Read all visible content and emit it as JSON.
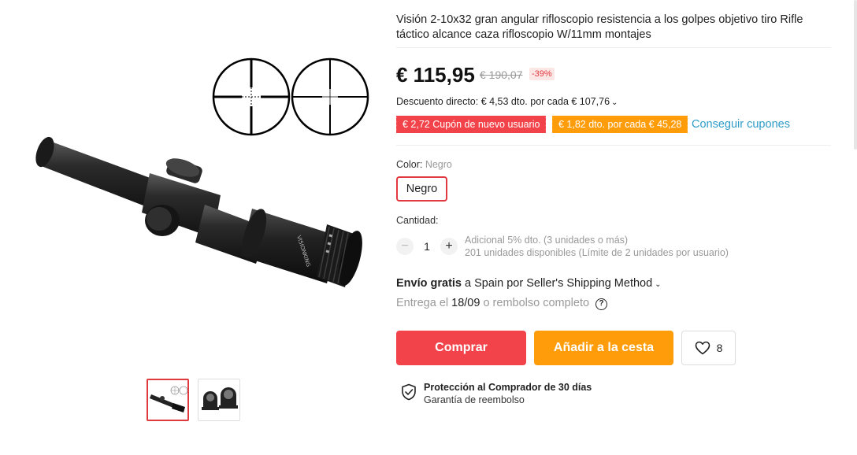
{
  "product": {
    "title": "Visión 2-10x32 gran angular rifloscopio resistencia a los golpes objetivo tiro Rifle táctico alcance caza rifloscopio W/11mm montajes"
  },
  "gallery": {
    "main_image_icon": "rifle-scope-with-reticles",
    "thumbnails": [
      {
        "icon": "rifle-scope-thumbnail",
        "active": true
      },
      {
        "icon": "scope-mounts-thumbnail",
        "active": false
      }
    ]
  },
  "pricing": {
    "price": "€ 115,95",
    "original_price": "€ 190,07",
    "discount_badge": "-39%",
    "direct_discount": "Descuento directo: € 4,53 dto. por cada € 107,76",
    "chevron": "⌄"
  },
  "coupons": {
    "new_user": "€ 2,72 Cupón de nuevo usuario",
    "store": "€ 1,82 dto. por cada € 45,28",
    "get_link": "Conseguir cupones"
  },
  "color": {
    "label": "Color:",
    "selected": "Negro",
    "options": [
      "Negro"
    ]
  },
  "quantity": {
    "label": "Cantidad:",
    "minus": "−",
    "plus": "+",
    "value": "1",
    "note1": "Adicional 5% dto. (3 unidades o más)",
    "note2": "201 unidades disponibles (Límite de 2 unidades por usuario)"
  },
  "shipping": {
    "free": "Envío gratis",
    "rest": "a Spain por Seller's Shipping Method",
    "chevron": "⌄",
    "delivery_prefix": "Entrega el",
    "delivery_date": "18/09",
    "delivery_suffix": "o rembolso completo",
    "help": "?"
  },
  "actions": {
    "buy": "Comprar",
    "add_to_cart": "Añadir a la cesta",
    "wishlist_count": "8"
  },
  "protection": {
    "title": "Protección al Comprador de 30 días",
    "subtitle": "Garantía de reembolso"
  },
  "colors": {
    "accent_red": "#f2434a",
    "accent_orange": "#ff9c0a",
    "link_blue": "#2e9cc9"
  }
}
